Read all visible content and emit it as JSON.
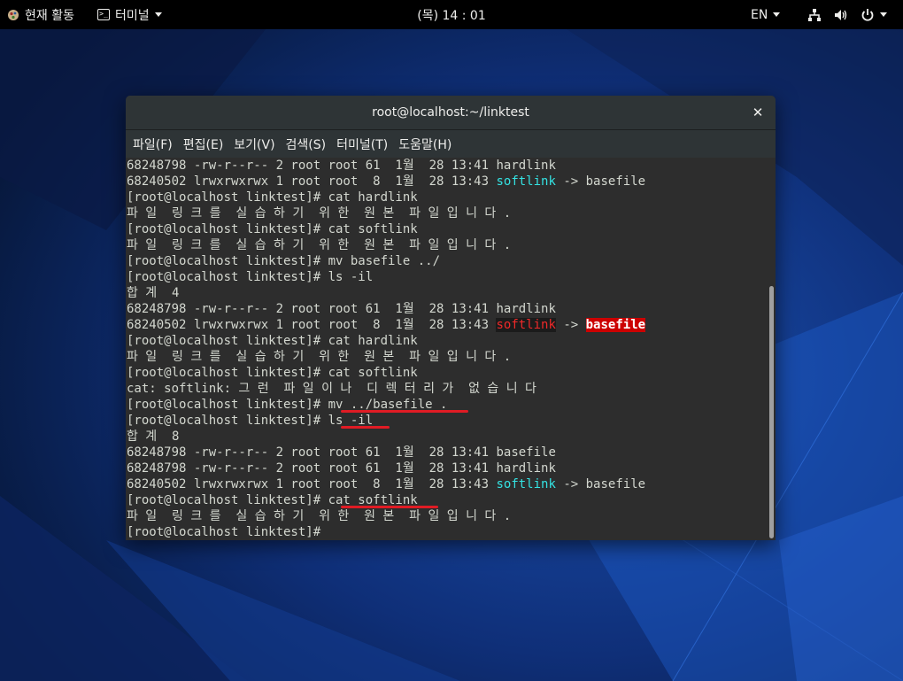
{
  "topbar": {
    "activities_label": "현재 활동",
    "app_menu_label": "터미널",
    "clock": "(목) 14 : 01",
    "language": "EN"
  },
  "window": {
    "title": "root@localhost:~/linktest",
    "menu": [
      "파일(F)",
      "편집(E)",
      "보기(V)",
      "검색(S)",
      "터미널(T)",
      "도움말(H)"
    ]
  },
  "terminal": {
    "lines": [
      {
        "plain": "68248798 -rw-r--r-- 2 root root 61  1월  28 13:41 hardlink"
      },
      {
        "pre": "68240502 lrwxrwxrwx 1 root root  8  1월  28 13:43 ",
        "link": "softlink",
        "post": " -> basefile"
      },
      {
        "plain": "[root@localhost linktest]# cat hardlink"
      },
      {
        "plain": "파 일  링 크 를  실 습 하 기  위 한  원 본  파 일 입 니 다 ."
      },
      {
        "plain": "[root@localhost linktest]# cat softlink"
      },
      {
        "plain": "파 일  링 크 를  실 습 하 기  위 한  원 본  파 일 입 니 다 ."
      },
      {
        "plain": "[root@localhost linktest]# mv basefile ../"
      },
      {
        "plain": "[root@localhost linktest]# ls -il"
      },
      {
        "plain": "합 계  4"
      },
      {
        "plain": "68248798 -rw-r--r-- 2 root root 61  1월  28 13:41 hardlink"
      },
      {
        "pre": "68240502 lrwxrwxrwx 1 root root  8  1월  28 13:43 ",
        "broken": "softlink",
        "post": " -> ",
        "broken_target": "basefile"
      },
      {
        "plain": "[root@localhost linktest]# cat hardlink"
      },
      {
        "plain": "파 일  링 크 를  실 습 하 기  위 한  원 본  파 일 입 니 다 ."
      },
      {
        "plain": "[root@localhost linktest]# cat softlink"
      },
      {
        "plain": "cat: softlink: 그 런  파 일 이 나  디 렉 터 리 가  없 습 니 다"
      },
      {
        "plain": "[root@localhost linktest]# mv ../basefile ."
      },
      {
        "plain": "[root@localhost linktest]# ls -il"
      },
      {
        "plain": "합 계  8"
      },
      {
        "plain": "68248798 -rw-r--r-- 2 root root 61  1월  28 13:41 basefile"
      },
      {
        "plain": "68248798 -rw-r--r-- 2 root root 61  1월  28 13:41 hardlink"
      },
      {
        "pre": "68240502 lrwxrwxrwx 1 root root  8  1월  28 13:43 ",
        "link": "softlink",
        "post": " -> basefile"
      },
      {
        "plain": "[root@localhost linktest]# cat softlink"
      },
      {
        "plain": "파 일  링 크 를  실 습 하 기  위 한  원 본  파 일 입 니 다 ."
      },
      {
        "plain": "[root@localhost linktest]# "
      }
    ]
  },
  "colors": {
    "link_color": "#34e2e2",
    "broken_link_color": "#ef2929",
    "annotation_color": "#e01b24"
  }
}
